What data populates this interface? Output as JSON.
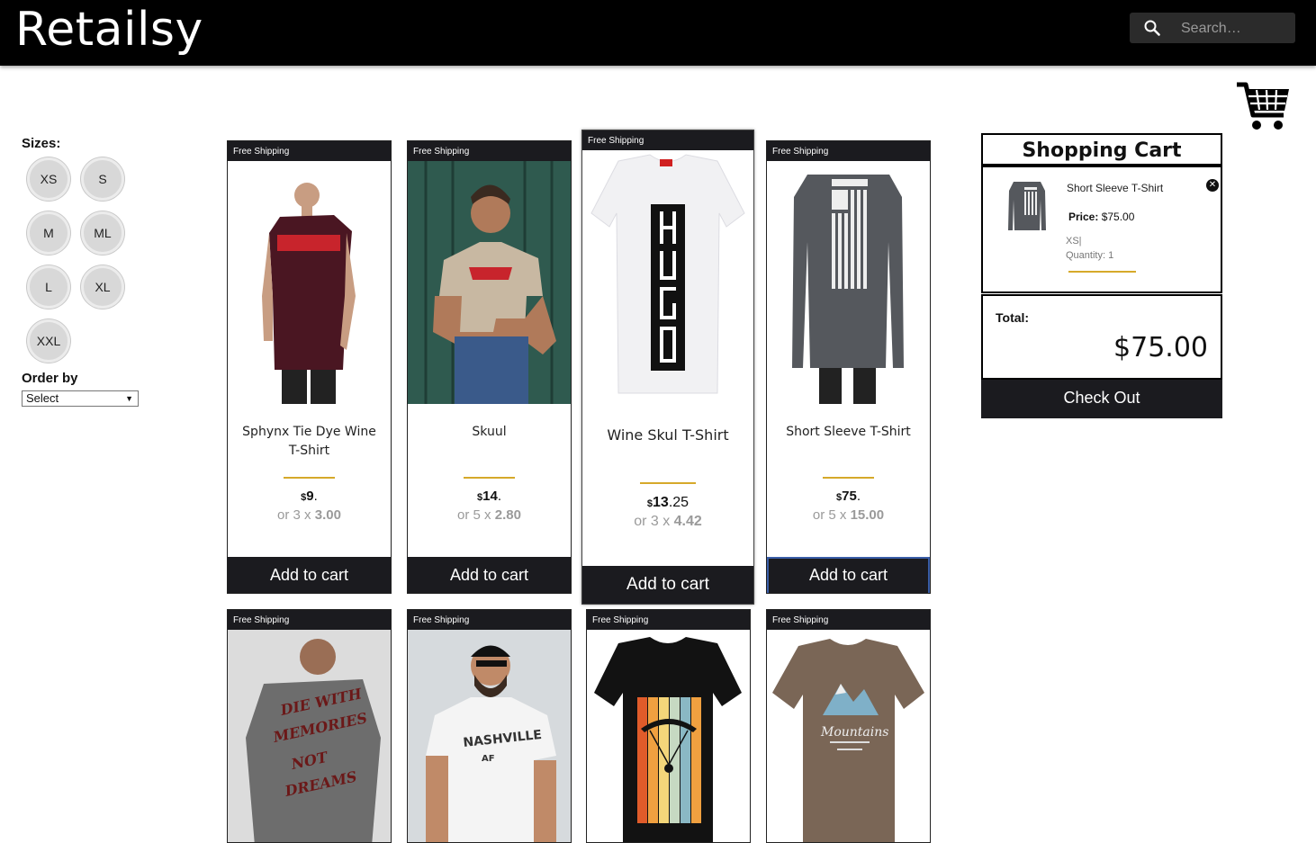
{
  "header": {
    "logo": "Retailsy",
    "search_placeholder": "Search…"
  },
  "filters": {
    "sizes_title": "Sizes:",
    "sizes": [
      "XS",
      "S",
      "M",
      "ML",
      "L",
      "XL",
      "XXL"
    ],
    "order_title": "Order by",
    "order_value": "Select"
  },
  "products": [
    {
      "ship": "Free Shipping",
      "title": "Sphynx Tie Dye Wine T-Shirt",
      "currency": "$",
      "int": "9",
      "dec": ".",
      "inst_prefix": "or 3 x",
      "inst_value": "3.00",
      "add_label": "Add to cart"
    },
    {
      "ship": "Free Shipping",
      "title": "Skuul",
      "currency": "$",
      "int": "14",
      "dec": ".",
      "inst_prefix": "or 5 x",
      "inst_value": "2.80",
      "add_label": "Add to cart"
    },
    {
      "ship": "Free Shipping",
      "title": "Wine Skul T-Shirt",
      "currency": "$",
      "int": "13",
      "dec": ".25",
      "inst_prefix": "or 3 x",
      "inst_value": "4.42",
      "add_label": "Add to cart"
    },
    {
      "ship": "Free Shipping",
      "title": "Short Sleeve T-Shirt",
      "currency": "$",
      "int": "75",
      "dec": ".",
      "inst_prefix": "or 5 x",
      "inst_value": "15.00",
      "add_label": "Add to cart"
    },
    {
      "ship": "Free Shipping"
    },
    {
      "ship": "Free Shipping"
    },
    {
      "ship": "Free Shipping"
    },
    {
      "ship": "Free Shipping"
    }
  ],
  "cart": {
    "title": "Shopping Cart",
    "item": {
      "name": "Short Sleeve T-Shirt",
      "price_label": "Price:",
      "price": "$75.00",
      "size": "XS|",
      "quantity": "Quantity: 1"
    },
    "total_label": "Total:",
    "total": "$75.00",
    "checkout_label": "Check Out"
  },
  "colors": {
    "header_bg": "#000000",
    "button_bg": "#1b1b1f",
    "accent_rule": "#d6a92a"
  }
}
